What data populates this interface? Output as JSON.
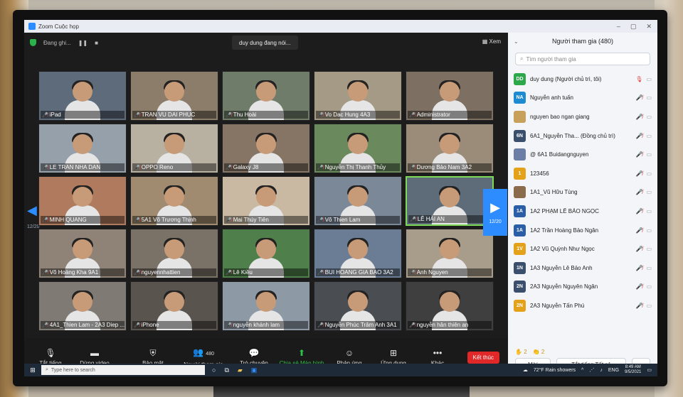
{
  "window": {
    "title": "Zoom Cuộc họp"
  },
  "topbar": {
    "recording_text": "Đang ghi...",
    "speaking": "duy dung đang nói...",
    "view_label": "Xem"
  },
  "grid": {
    "page_left": "12/20",
    "page_right": "12/20",
    "tiles": [
      {
        "name": "iPad",
        "muted": true
      },
      {
        "name": "TRAN VU DAI PHUC",
        "muted": true
      },
      {
        "name": "Thu Hoài",
        "muted": true
      },
      {
        "name": "Vo Dac Hung 4A3",
        "muted": true
      },
      {
        "name": "Administrator",
        "muted": true
      },
      {
        "name": "LE TRAN NHA DAN",
        "muted": true
      },
      {
        "name": "OPPO Reno",
        "muted": true
      },
      {
        "name": "Galaxy J8",
        "muted": true
      },
      {
        "name": "Nguyễn Thị Thanh Thủy",
        "muted": true
      },
      {
        "name": "Dương Bảo Nam 3A2",
        "muted": true
      },
      {
        "name": "MINH QUANG",
        "muted": true
      },
      {
        "name": "5A1 Võ Trương Thịnh",
        "muted": true
      },
      {
        "name": "Mai Thúy Tiên",
        "muted": true
      },
      {
        "name": "Võ Thien Lam",
        "muted": true
      },
      {
        "name": "LÊ HẢI AN",
        "muted": true
      },
      {
        "name": "Võ Hoàng Kha 9A1",
        "muted": true
      },
      {
        "name": "nguyennhattien",
        "muted": true
      },
      {
        "name": "Lê Kiều",
        "muted": true
      },
      {
        "name": "BUI HOANG GIA BAO 3A2",
        "muted": true
      },
      {
        "name": "Anh Nguyen",
        "muted": true
      },
      {
        "name": "4A1_Thien Lam - 2A3 Diep ...",
        "muted": true
      },
      {
        "name": "iPhone",
        "muted": true
      },
      {
        "name": "nguyễn khánh lam",
        "muted": true
      },
      {
        "name": "Nguyễn Phúc Trâm Anh 3A1",
        "muted": true
      },
      {
        "name": "nguyễn hân thiên an",
        "muted": true
      }
    ]
  },
  "toolbar": {
    "mute": "Tắt tiếng",
    "video": "Dừng video",
    "security": "Bảo mật",
    "participants": "Người tham gia",
    "participants_count": "480",
    "chat": "Trò chuyện",
    "share": "Chia sẻ Màn hình",
    "reactions": "Phản ứng",
    "apps": "Ứng dụng",
    "more": "Khác",
    "end": "Kết thúc"
  },
  "panel": {
    "title": "Người tham gia (480)",
    "search_placeholder": "Tìm người tham gia",
    "participants": [
      {
        "initials": "DD",
        "color": "#2aa84a",
        "name": "duy dung (Người chủ trì, tôi)"
      },
      {
        "initials": "NA",
        "color": "#1d8bd1",
        "name": "Nguyễn anh tuấn"
      },
      {
        "initials": "",
        "color": "#c7a15a",
        "name": "nguyen bao ngan giang"
      },
      {
        "initials": "6N",
        "color": "#3a4f6b",
        "name": "6A1_Nguyễn Tha... (Đồng chủ trì)"
      },
      {
        "initials": "",
        "color": "#6b7fa6",
        "name": "@ 6A1 Buidangnguyen"
      },
      {
        "initials": "1",
        "color": "#e3a21a",
        "name": "123456"
      },
      {
        "initials": "",
        "color": "#8a6b4a",
        "name": "1A1_Vũ Hữu Tùng"
      },
      {
        "initials": "1A",
        "color": "#2a5fa8",
        "name": "1A2 PHẠM LÊ BẢO NGỌC"
      },
      {
        "initials": "1A",
        "color": "#2a5fa8",
        "name": "1A2 Trần Hoàng Bảo Ngân"
      },
      {
        "initials": "1V",
        "color": "#e3a21a",
        "name": "1A2 Vũ Quỳnh Như Ngọc"
      },
      {
        "initials": "1N",
        "color": "#3a4f6b",
        "name": "1A3 Nguyễn Lê Bảo Anh"
      },
      {
        "initials": "2N",
        "color": "#3a4f6b",
        "name": "2A3 Nguyễn Nguyên Ngân"
      },
      {
        "initials": "2N",
        "color": "#e3a21a",
        "name": "2A3 Nguyễn Tấn Phú"
      }
    ],
    "reaction_raise": "2",
    "reaction_clap": "2",
    "invite": "Mời",
    "mute_all": "Tắt tiếng Tất cả",
    "more": "..."
  },
  "taskbar": {
    "search_placeholder": "Type here to search",
    "weather": "72°F  Rain showers",
    "lang": "ENG",
    "time": "8:49 AM",
    "date": "9/5/2021"
  }
}
